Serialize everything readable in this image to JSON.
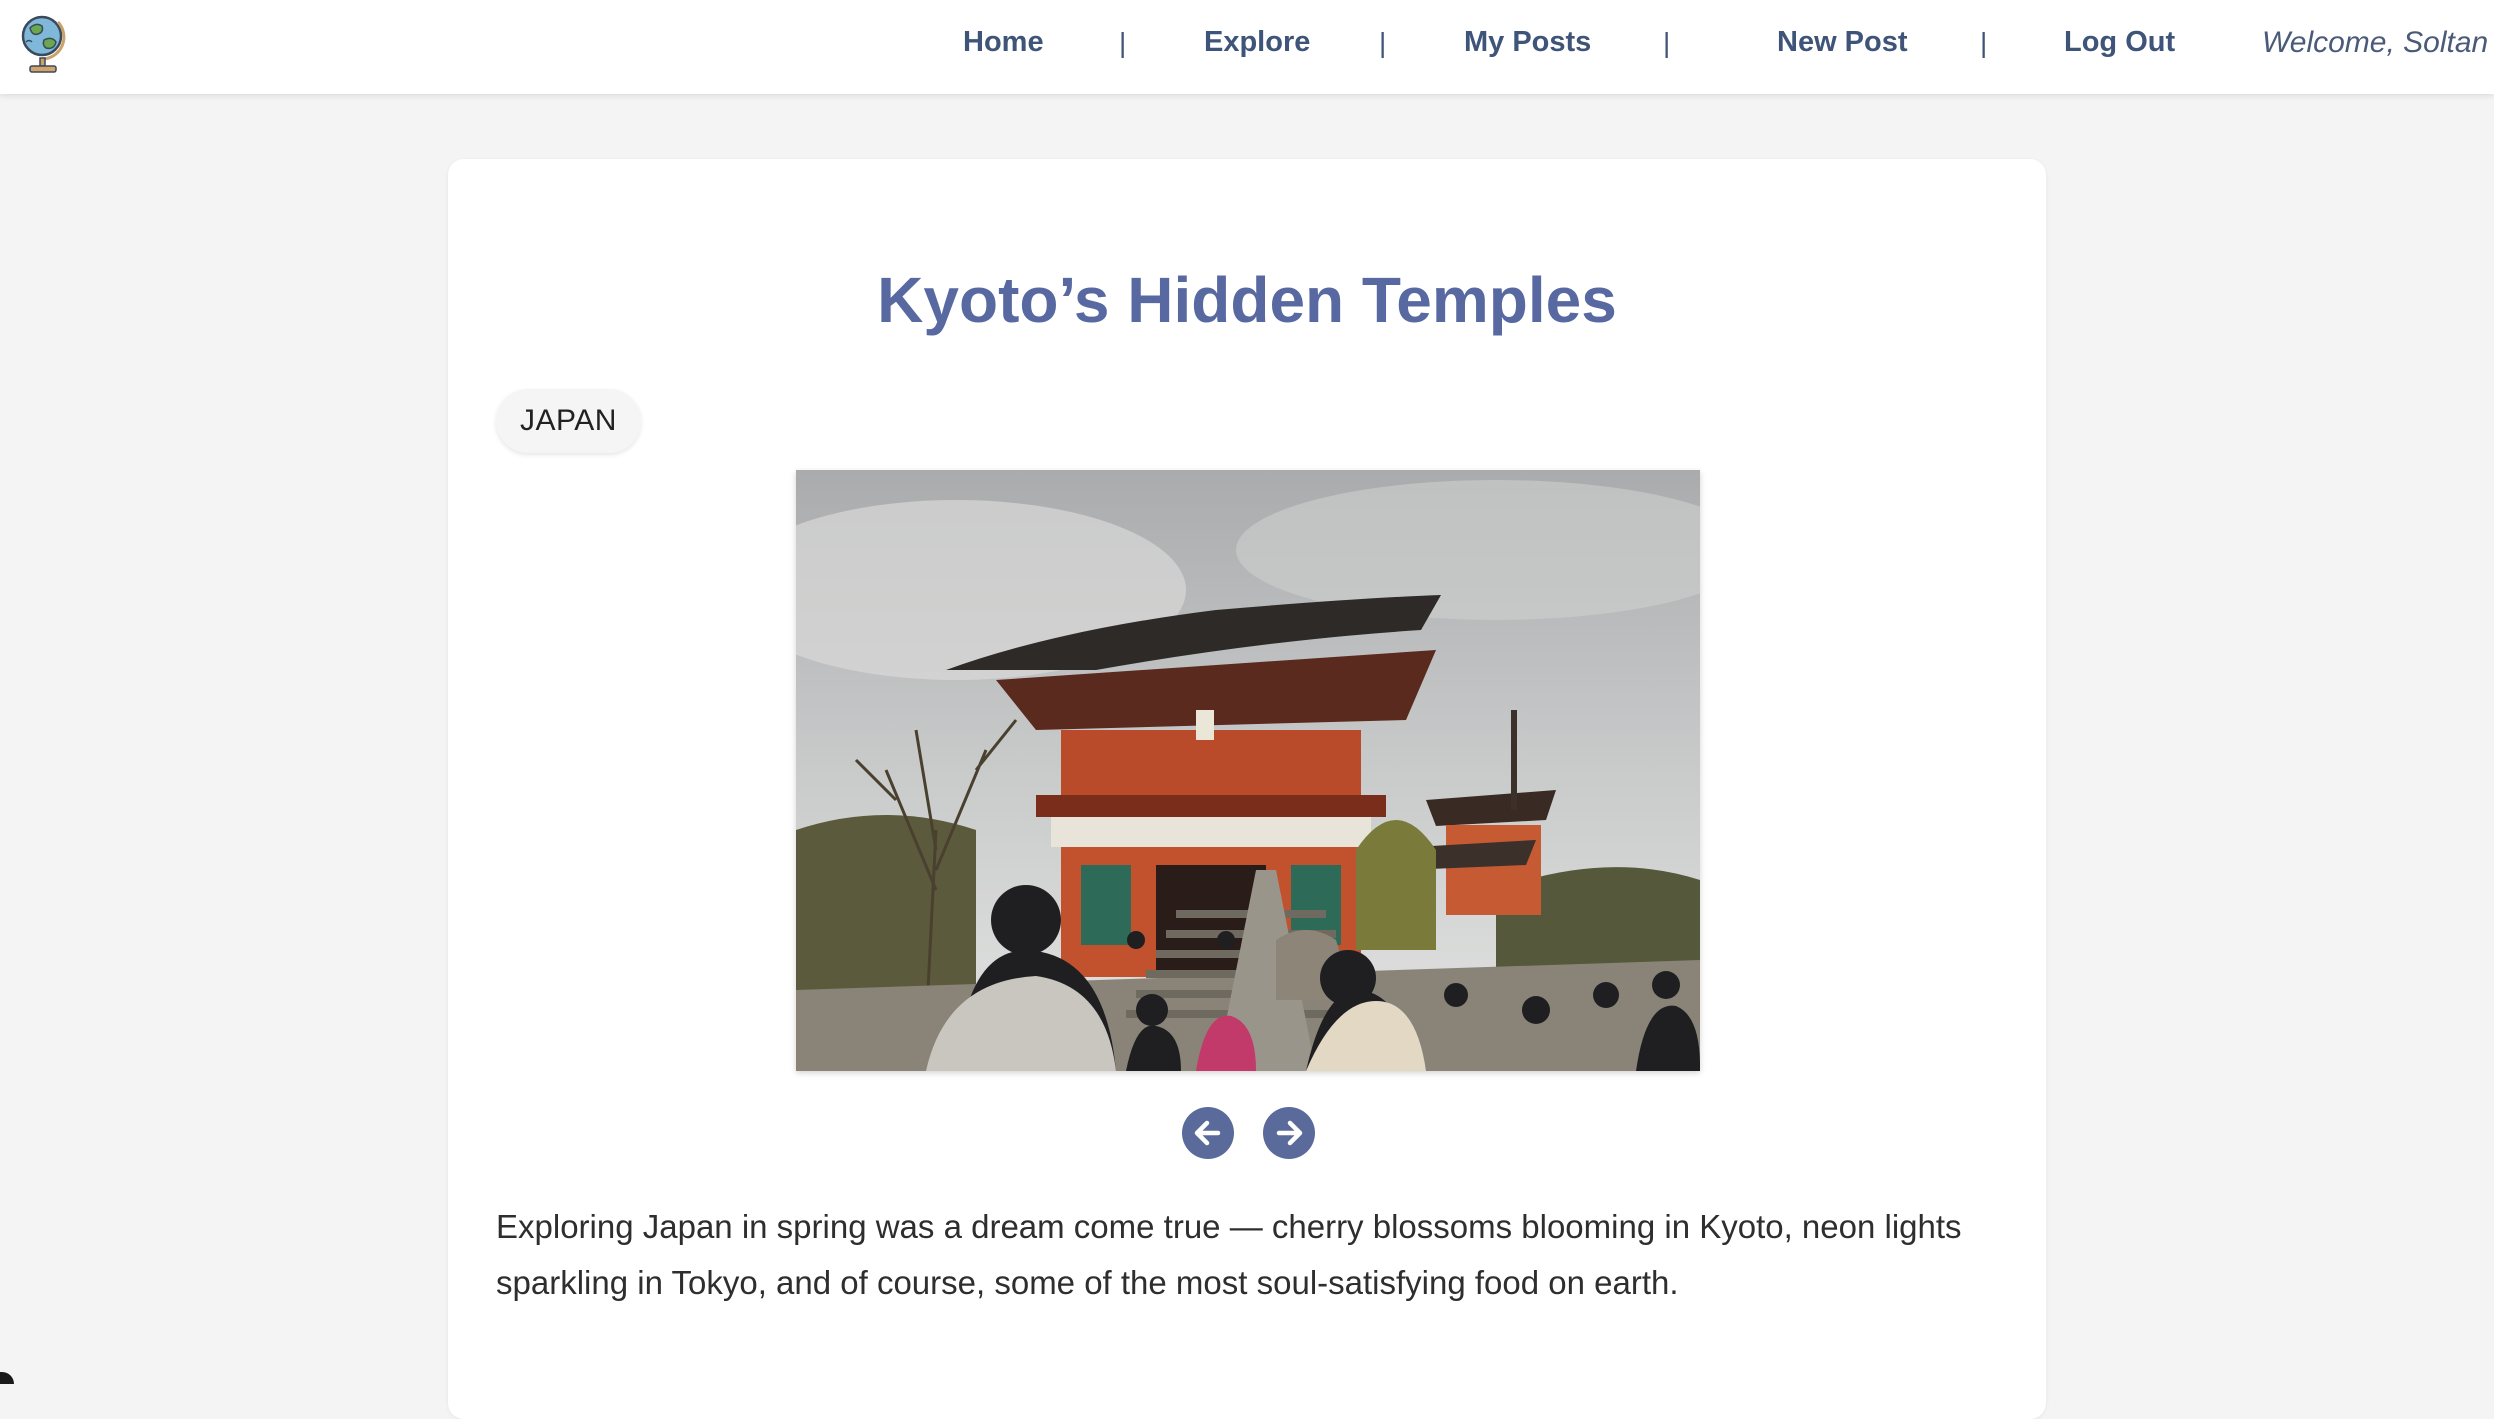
{
  "nav": {
    "home": "Home",
    "explore": "Explore",
    "my_posts": "My Posts",
    "new_post": "New Post",
    "log_out": "Log Out",
    "separator": "|",
    "welcome": "Welcome, Soltan"
  },
  "post": {
    "title": "Kyoto’s Hidden Temples",
    "tag": "JAPAN",
    "body": "Exploring Japan in spring was a dream come true — cherry blossoms blooming in Kyoto, neon lights sparkling in Tokyo, and of course, some of the most soul-satisfying food on earth."
  },
  "icons": {
    "logo": "globe-icon",
    "prev": "arrow-left-icon",
    "next": "arrow-right-icon"
  },
  "colors": {
    "nav_text": "#3e5478",
    "title": "#5868a0",
    "button": "#5a6a9a",
    "background": "#f4f4f4"
  }
}
